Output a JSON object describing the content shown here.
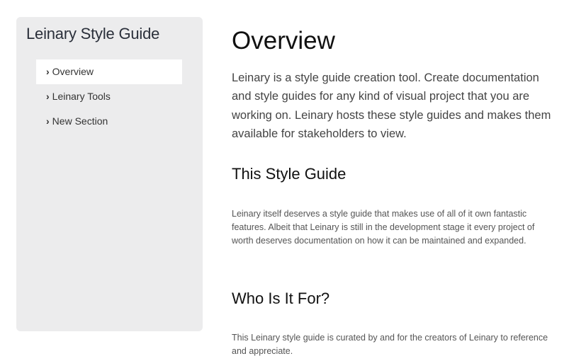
{
  "sidebar": {
    "title": "Leinary Style Guide",
    "items": [
      {
        "label": "Overview",
        "active": true
      },
      {
        "label": "Leinary Tools",
        "active": false
      },
      {
        "label": "New Section",
        "active": false
      }
    ],
    "chevron": "›"
  },
  "main": {
    "title": "Overview",
    "intro": "Leinary is a style guide creation tool. Create documentation and style guides for any kind of visual project that you are working on. Leinary hosts these style guides and makes them available for stakeholders to view.",
    "sections": [
      {
        "heading": "This Style Guide",
        "body": "Leinary itself deserves a style guide that makes use of all of it own fantastic features. Albeit that Leinary is still in the development stage it every project of worth deserves documentation on how it can be maintained and expanded."
      },
      {
        "heading": "Who Is It For?",
        "body": "This Leinary style guide is curated by and for the creators of Leinary to reference and appreciate."
      }
    ]
  }
}
